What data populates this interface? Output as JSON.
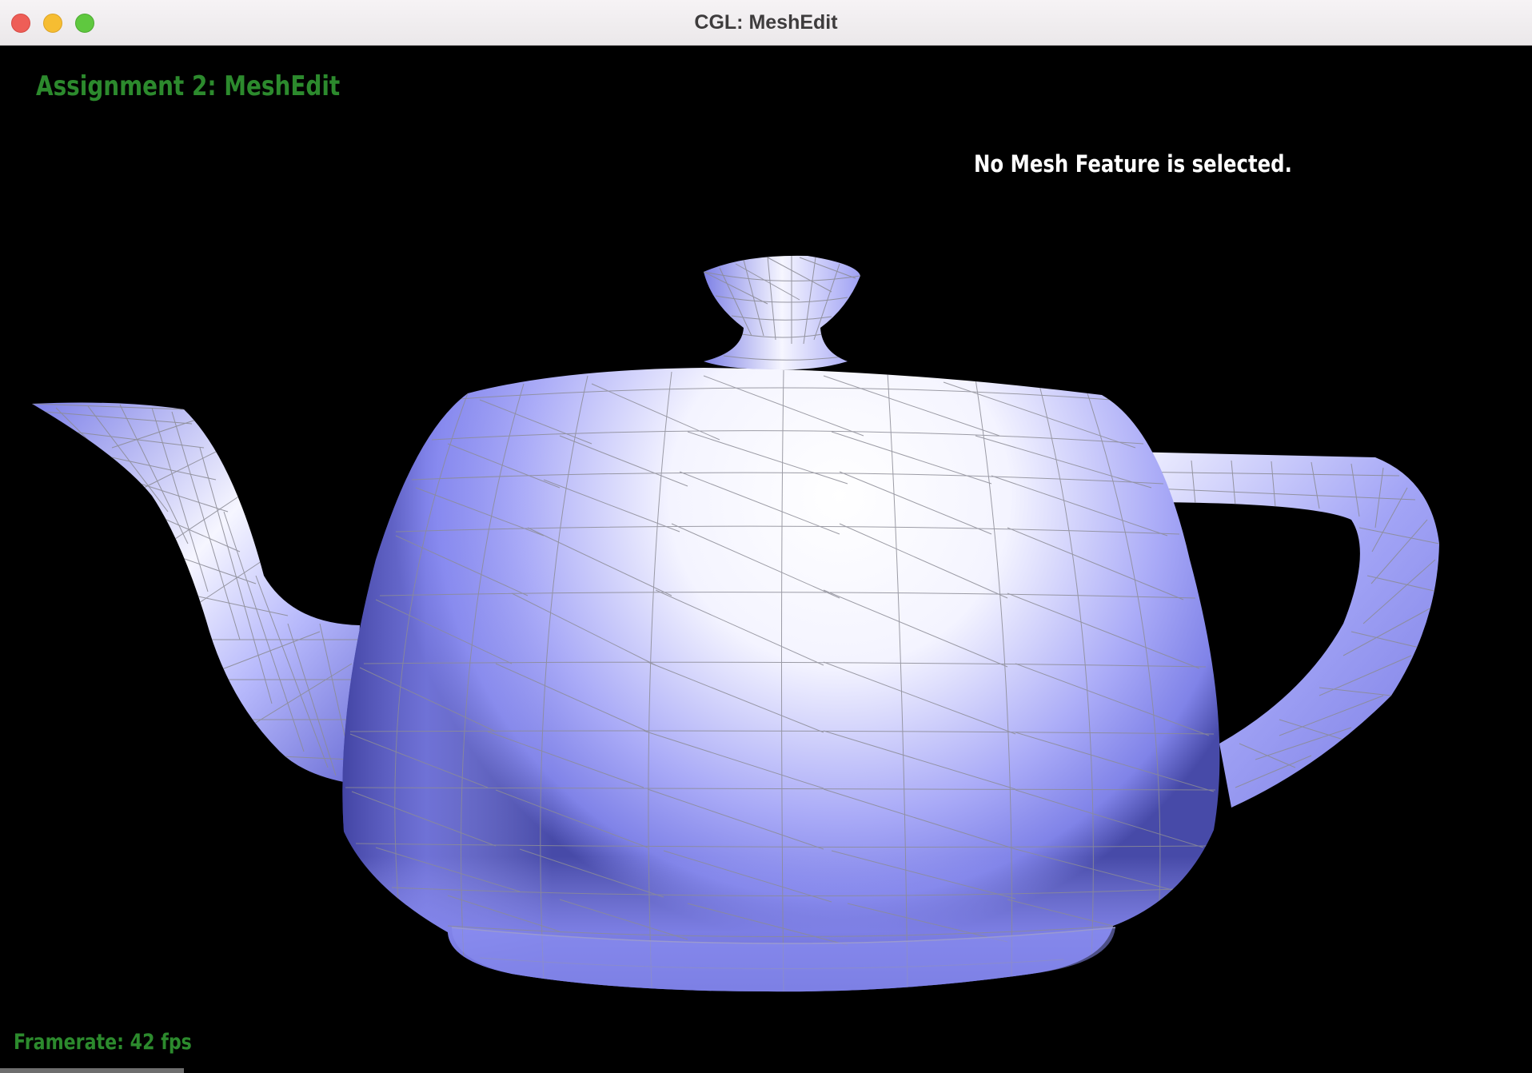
{
  "window": {
    "title": "CGL: MeshEdit"
  },
  "hud": {
    "assignment_title": "Assignment 2: MeshEdit",
    "selection_status": "No Mesh Feature is selected.",
    "framerate": "Framerate: 42 fps"
  },
  "colors": {
    "hud_green": "#2c8a2d",
    "mesh_light": "#ffffff",
    "mesh_shade": "#8a8cf5",
    "mesh_dark": "#3f40a0",
    "wireframe": "#8c8c96"
  },
  "icons": [
    "close-button",
    "minimize-button",
    "zoom-button"
  ]
}
